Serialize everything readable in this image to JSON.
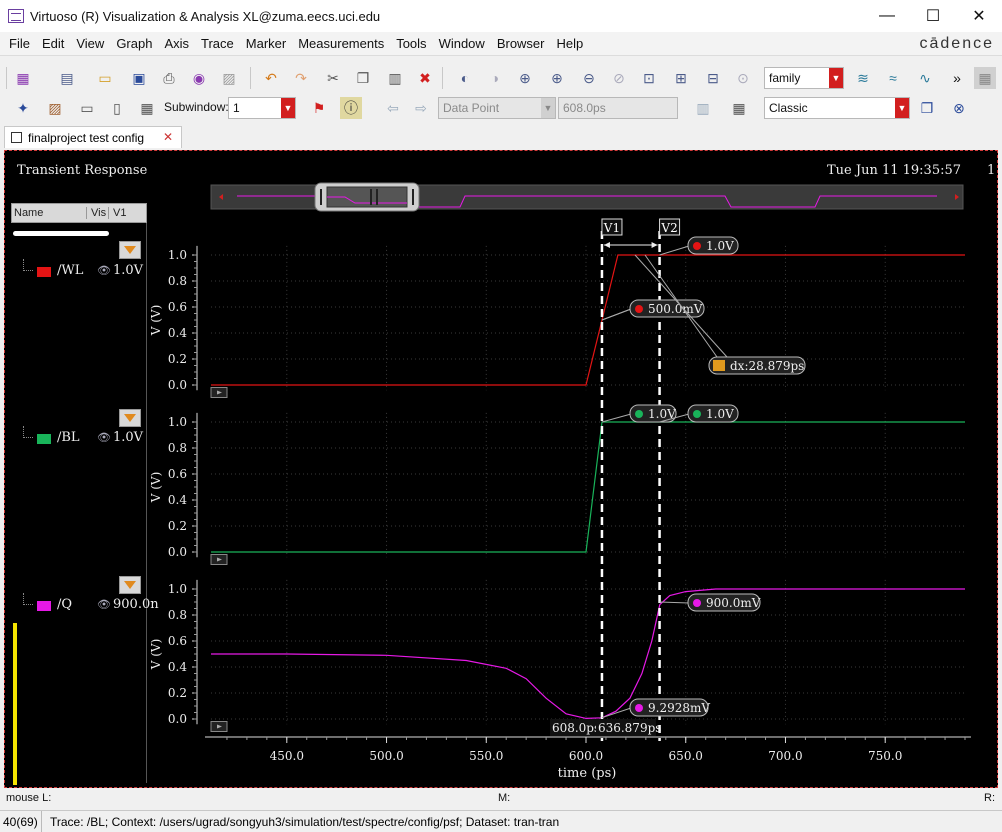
{
  "window": {
    "title": "Virtuoso (R) Visualization & Analysis XL@zuma.eecs.uci.edu",
    "minimize": "—",
    "maximize": "☐",
    "close": "✕"
  },
  "menu": {
    "items": [
      "File",
      "Edit",
      "View",
      "Graph",
      "Axis",
      "Trace",
      "Marker",
      "Measurements",
      "Tools",
      "Window",
      "Browser",
      "Help"
    ],
    "brand": "cādence"
  },
  "toolbar": {
    "family_select": "family",
    "overflow": "»"
  },
  "toolbar2": {
    "subwindow_label": "Subwindow:",
    "subwindow_value": "1",
    "data_point": "Data Point",
    "point_value": "608.0ps",
    "style_select": "Classic"
  },
  "tab": {
    "label": "finalproject test config",
    "close": "✕"
  },
  "graph": {
    "title": "Transient Response",
    "date": "Tue Jun 11 19:35:57",
    "date_extra": "1",
    "xlabel": "time (ps)",
    "ylabel": "V (V)",
    "xticks": [
      "450.0",
      "500.0",
      "550.0",
      "600.0",
      "650.0",
      "700.0",
      "750.0"
    ],
    "yticks": [
      "0.0",
      "0.2",
      "0.4",
      "0.6",
      "0.8",
      "1.0"
    ]
  },
  "legend": {
    "headers": [
      "Name",
      "Vis",
      "V1"
    ],
    "eye": "👁",
    "traces": [
      {
        "name": "/WL",
        "value": "1.0V",
        "color": "#e41414"
      },
      {
        "name": "/BL",
        "value": "1.0V",
        "color": "#19b45a"
      },
      {
        "name": "/Q",
        "value": "900.0n",
        "color": "#e619e6"
      }
    ]
  },
  "markers": {
    "v1_label": "V1",
    "v2_label": "V2",
    "v1_time": 608.0,
    "v2_time": 636.879,
    "wl_v2": "1.0V",
    "wl_v1": "500.0mV",
    "delta": "dx:28.879ps",
    "bl_v1": "1.0V",
    "bl_v2": "1.0V",
    "q_v2": "900.0mV",
    "q_v1": "9.2928mV",
    "x_v1": "608.0ps",
    "x_v2": "636.879ps"
  },
  "chart_data": {
    "type": "line",
    "xlabel": "time (ps)",
    "ylabel": "V (V)",
    "xlim": [
      412,
      790
    ],
    "ylim": [
      -0.05,
      1.08
    ],
    "series": [
      {
        "name": "/WL",
        "color": "#e41414",
        "x": [
          412,
          600,
          608,
          616,
          790
        ],
        "y": [
          0.0,
          0.0,
          0.5,
          1.0,
          1.0
        ]
      },
      {
        "name": "/BL",
        "color": "#19b45a",
        "x": [
          412,
          600,
          608,
          790
        ],
        "y": [
          0.0,
          0.0,
          1.0,
          1.0
        ]
      },
      {
        "name": "/Q",
        "color": "#e619e6",
        "x": [
          412,
          450,
          500,
          540,
          560,
          570,
          580,
          590,
          600,
          608,
          615,
          622,
          628,
          633,
          637,
          642,
          650,
          665,
          790
        ],
        "y": [
          0.5,
          0.5,
          0.49,
          0.45,
          0.39,
          0.31,
          0.16,
          0.04,
          0.005,
          0.009,
          0.06,
          0.16,
          0.35,
          0.6,
          0.88,
          0.95,
          0.98,
          1.0,
          1.0
        ]
      }
    ]
  },
  "status": {
    "mouse": "mouse L:",
    "mid": "M:",
    "right": "R:",
    "count": "40(69)",
    "message": "Trace: /BL; Context: /users/ugrad/songyuh3/simulation/test/spectre/config/psf; Dataset: tran-tran"
  }
}
